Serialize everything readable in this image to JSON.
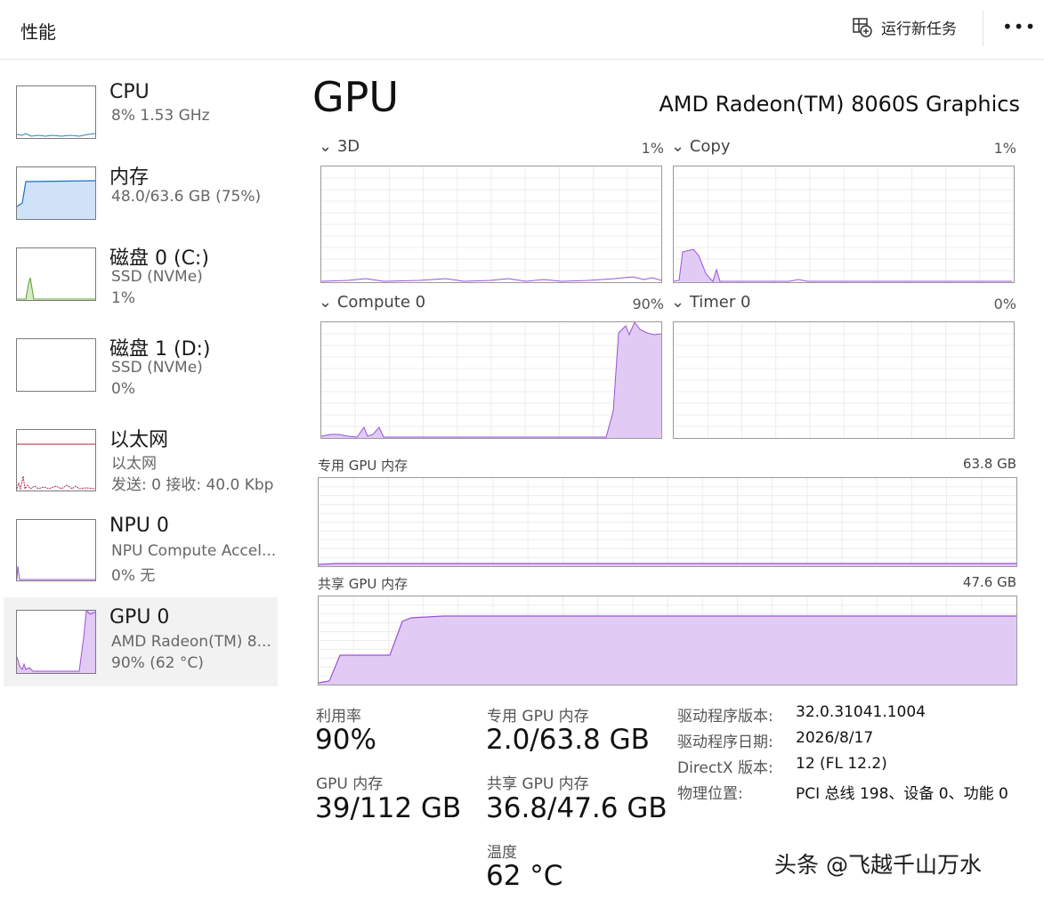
{
  "header": {
    "title": "性能",
    "run_task": "运行新任务",
    "more": "•••"
  },
  "sidebar": {
    "items": [
      {
        "name": "CPU",
        "line1": "8%  1.53 GHz",
        "line2": "",
        "selected": false
      },
      {
        "name": "内存",
        "line1": "48.0/63.6 GB (75%)",
        "line2": "",
        "selected": false
      },
      {
        "name": "磁盘 0 (C:)",
        "line1": "SSD (NVMe)",
        "line2": "1%",
        "selected": false
      },
      {
        "name": "磁盘 1 (D:)",
        "line1": "SSD (NVMe)",
        "line2": "0%",
        "selected": false
      },
      {
        "name": "以太网",
        "line1": "以太网",
        "line2": "发送: 0 接收: 40.0 Kbp",
        "selected": false
      },
      {
        "name": "NPU 0",
        "line1": "NPU Compute Accel...",
        "line2": "0% 无",
        "selected": false
      },
      {
        "name": "GPU 0",
        "line1": "AMD Radeon(TM) 8...",
        "line2": "90% (62 °C)",
        "selected": true
      }
    ]
  },
  "main": {
    "title": "GPU",
    "device_name": "AMD Radeon(TM) 8060S Graphics",
    "engines": [
      {
        "name": "3D",
        "percent": "1%"
      },
      {
        "name": "Copy",
        "percent": "1%"
      },
      {
        "name": "Compute 0",
        "percent": "90%"
      },
      {
        "name": "Timer 0",
        "percent": "0%"
      }
    ],
    "dedicated_mem": {
      "label": "专用 GPU 内存",
      "max": "63.8 GB"
    },
    "shared_mem": {
      "label": "共享 GPU 内存",
      "max": "47.6 GB"
    }
  },
  "stats": {
    "utilization": {
      "label": "利用率",
      "value": "90%"
    },
    "gpu_memory": {
      "label": "GPU 内存",
      "value": "39/112 GB"
    },
    "dedicated": {
      "label": "专用 GPU 内存",
      "value": "2.0/63.8 GB"
    },
    "shared": {
      "label": "共享 GPU 内存",
      "value": "36.8/47.6 GB"
    },
    "temperature": {
      "label": "温度",
      "value": "62 °C"
    }
  },
  "info": [
    {
      "key": "驱动程序版本:",
      "value": "32.0.31041.1004"
    },
    {
      "key": "驱动程序日期:",
      "value": "2026/8/17"
    },
    {
      "key": "DirectX 版本:",
      "value": "12 (FL 12.2)"
    },
    {
      "key": "物理位置:",
      "value": "PCI 总线 198、设备 0、功能 0"
    }
  ],
  "watermark": "头条 @飞越千山万水",
  "colors": {
    "gpu_line": "#9a52d8",
    "gpu_fill": "#e1cbf5",
    "mem_line": "#1f6fc4",
    "mem_fill": "#cfe2f8",
    "disk": "#5aa02c",
    "net": "#b3203f"
  }
}
